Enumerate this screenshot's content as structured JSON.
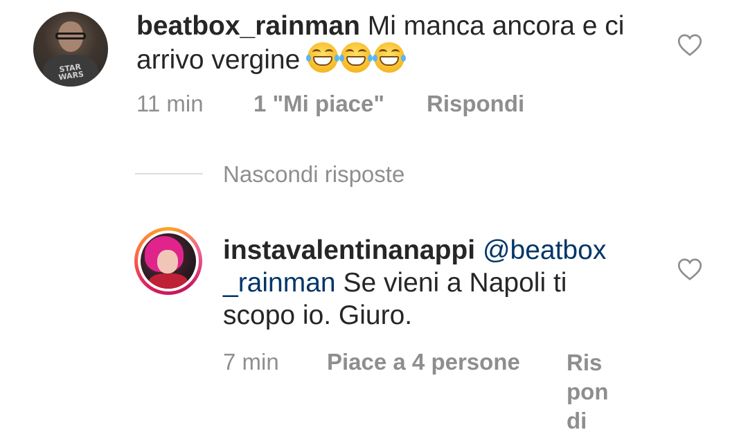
{
  "comments": [
    {
      "username": "beatbox_rainman",
      "text_line1": "Mi manca ancora e ci",
      "text_line2": "arrivo vergine",
      "emoji": [
        "tears-of-joy-emoji",
        "tears-of-joy-emoji",
        "tears-of-joy-emoji"
      ],
      "time": "11 min",
      "likes": "1 \"Mi piace\"",
      "reply_label": "Rispondi",
      "avatar_text": "STAR WARS"
    }
  ],
  "hide_replies_label": "Nascondi risposte",
  "reply": {
    "username": "instavalentinanappi",
    "mention": "@beatbox",
    "mention_cont": "_rainman",
    "text_part1": "Se vieni a Napoli ti",
    "text_line3": "scopo io. Giuro.",
    "time": "7 min",
    "likes": "Piace a 4 persone",
    "reply_label_lines": [
      "Ris",
      "pon",
      "di"
    ]
  },
  "colors": {
    "text": "#262626",
    "secondary": "#8e8e8e",
    "mention": "#003569",
    "divider": "#dbdbdb"
  }
}
